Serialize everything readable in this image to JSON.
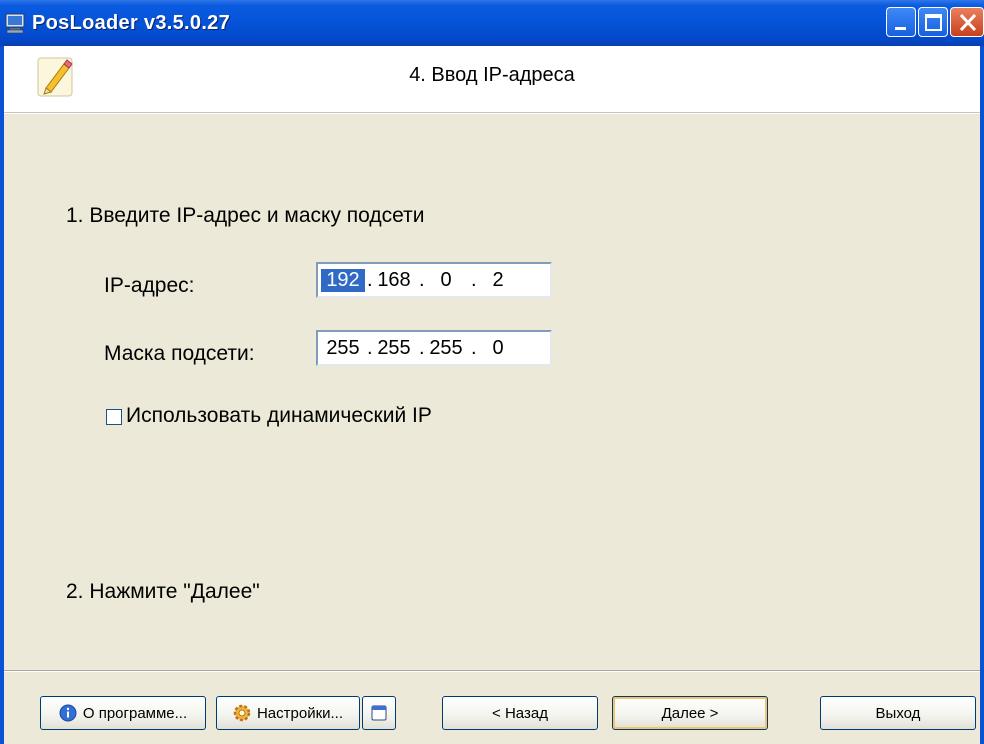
{
  "window": {
    "title": "PosLoader v3.5.0.27"
  },
  "header": {
    "step_title": "4. Ввод IP-адреса"
  },
  "section1": {
    "heading": "1. Введите IP-адрес и маску подсети",
    "ip_label": "IP-адрес:",
    "ip_octets": [
      "192",
      "168",
      "0",
      "2"
    ],
    "mask_label": "Маска подсети:",
    "mask_octets": [
      "255",
      "255",
      "255",
      "0"
    ],
    "dynamic_ip_label": "Использовать динамический IP",
    "dynamic_ip_checked": false
  },
  "section2": {
    "heading": "2. Нажмите \"Далее\""
  },
  "footer": {
    "about_label": "О программе...",
    "settings_label": "Настройки...",
    "back_label": "< Назад",
    "next_label": "Далее >",
    "exit_label": "Выход"
  },
  "colors": {
    "titlebar": "#0553d8",
    "selection": "#316ac5",
    "dialog_bg": "#ece9d8"
  }
}
